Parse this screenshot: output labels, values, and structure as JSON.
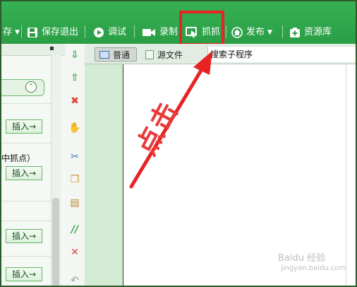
{
  "toolbar": {
    "items": {
      "save_partial": "存",
      "save_exit": "保存退出",
      "debug": "调试",
      "record": "录制",
      "grab": "抓抓",
      "publish": "发布",
      "resources": "资源库"
    }
  },
  "left_panel": {
    "insert_label": "插入→",
    "truncated_text": "中抓点）"
  },
  "editor": {
    "tabs": [
      "普通",
      "源文件"
    ],
    "subprogram": "搜索子程序"
  },
  "annotation": {
    "text": "点击",
    "color": "#e83a3a"
  },
  "colors": {
    "toolbar_green": "#36b154",
    "highlight_red": "#e82323",
    "gutter_green": "#d3ead3"
  },
  "watermark": {
    "line1": "Baidu 经验",
    "line2": "jingyan.baidu.com"
  }
}
